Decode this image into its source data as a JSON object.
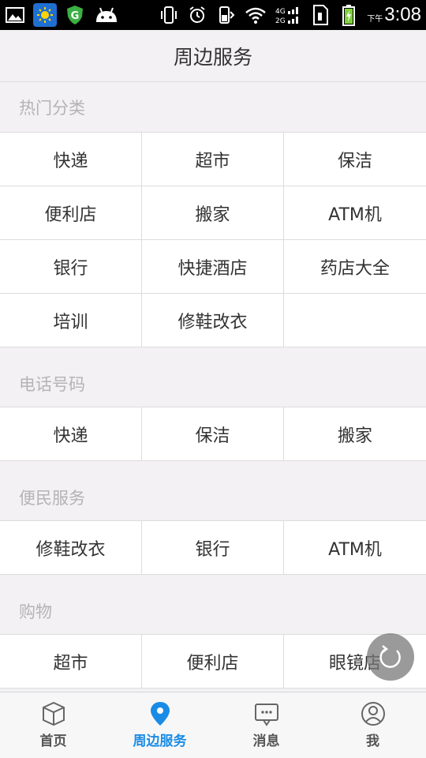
{
  "status_bar": {
    "network": "4G 2G",
    "time_prefix": "下午",
    "time": "3:08",
    "icons": [
      "gallery-icon",
      "weather-sun-icon",
      "shield-g-icon",
      "android-icon",
      "vibrate-icon",
      "alarm-icon",
      "phone-battery-icon",
      "wifi-icon",
      "signal-icon",
      "sim-icon",
      "battery-charging-icon"
    ]
  },
  "header": {
    "title": "周边服务"
  },
  "sections": [
    {
      "title": "热门分类",
      "items": [
        "快递",
        "超市",
        "保洁",
        "便利店",
        "搬家",
        "ATM机",
        "银行",
        "快捷酒店",
        "药店大全",
        "培训",
        "修鞋改衣",
        ""
      ]
    },
    {
      "title": "电话号码",
      "items": [
        "快递",
        "保洁",
        "搬家"
      ]
    },
    {
      "title": "便民服务",
      "items": [
        "修鞋改衣",
        "银行",
        "ATM机"
      ]
    },
    {
      "title": "购物",
      "items": [
        "超市",
        "便利店",
        "眼镜店"
      ]
    }
  ],
  "tabbar": {
    "tabs": [
      {
        "label": "首页",
        "icon": "cube-icon"
      },
      {
        "label": "周边服务",
        "icon": "location-pin-icon",
        "active": true
      },
      {
        "label": "消息",
        "icon": "message-icon"
      },
      {
        "label": "我",
        "icon": "user-icon"
      }
    ]
  },
  "colors": {
    "accent": "#1a8ce6",
    "section_title": "#b4b4b4",
    "background": "#f3f1f4"
  }
}
